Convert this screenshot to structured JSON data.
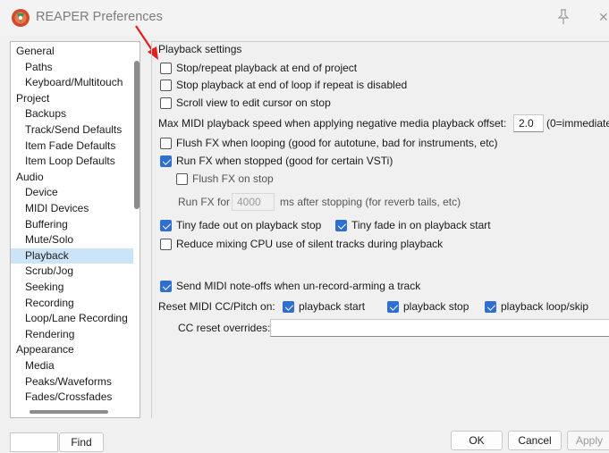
{
  "window": {
    "title": "REAPER Preferences"
  },
  "categories": [
    {
      "label": "General",
      "level": 0
    },
    {
      "label": "Paths",
      "level": 1
    },
    {
      "label": "Keyboard/Multitouch",
      "level": 1
    },
    {
      "label": "Project",
      "level": 0
    },
    {
      "label": "Backups",
      "level": 1
    },
    {
      "label": "Track/Send Defaults",
      "level": 1
    },
    {
      "label": "Item Fade Defaults",
      "level": 1
    },
    {
      "label": "Item Loop Defaults",
      "level": 1
    },
    {
      "label": "Audio",
      "level": 0
    },
    {
      "label": "Device",
      "level": 1
    },
    {
      "label": "MIDI Devices",
      "level": 1
    },
    {
      "label": "Buffering",
      "level": 1
    },
    {
      "label": "Mute/Solo",
      "level": 1
    },
    {
      "label": "Playback",
      "level": 1,
      "selected": true
    },
    {
      "label": "Scrub/Jog",
      "level": 1
    },
    {
      "label": "Seeking",
      "level": 1
    },
    {
      "label": "Recording",
      "level": 1
    },
    {
      "label": "Loop/Lane Recording",
      "level": 1
    },
    {
      "label": "Rendering",
      "level": 1
    },
    {
      "label": "Appearance",
      "level": 0
    },
    {
      "label": "Media",
      "level": 1
    },
    {
      "label": "Peaks/Waveforms",
      "level": 1
    },
    {
      "label": "Fades/Crossfades",
      "level": 1
    }
  ],
  "playback": {
    "section_title": "Playback settings",
    "stop_repeat_end_of_project": {
      "label": "Stop/repeat playback at end of project",
      "checked": false
    },
    "stop_end_of_loop": {
      "label": "Stop playback at end of loop if repeat is disabled",
      "checked": false
    },
    "scroll_view_cursor": {
      "label": "Scroll view to edit cursor on stop",
      "checked": false
    },
    "max_midi_speed": {
      "label": "Max MIDI playback speed when applying negative media playback offset:",
      "value": "2.0",
      "hint": "(0=immediate)"
    },
    "flush_fx_looping": {
      "label": "Flush FX when looping (good for autotune, bad for instruments, etc)",
      "checked": false
    },
    "run_fx_stopped": {
      "label": "Run FX when stopped (good for certain VSTi)",
      "checked": true
    },
    "flush_fx_stop": {
      "label": "Flush FX on stop",
      "checked": false
    },
    "run_fx_for": {
      "prefix": "Run FX for",
      "value": "4000",
      "suffix": "ms after stopping (for reverb tails, etc)"
    },
    "tiny_fade_out": {
      "label": "Tiny fade out on playback stop",
      "checked": true
    },
    "tiny_fade_in": {
      "label": "Tiny fade in on playback start",
      "checked": true
    },
    "reduce_cpu": {
      "label": "Reduce mixing CPU use of silent tracks during playback",
      "checked": false
    },
    "send_midi_noteoffs": {
      "label": "Send MIDI note-offs when un-record-arming a track",
      "checked": true
    },
    "reset_midi_label": "Reset MIDI CC/Pitch on:",
    "reset_playback_start": {
      "label": "playback start",
      "checked": true
    },
    "reset_playback_stop": {
      "label": "playback stop",
      "checked": true
    },
    "reset_playback_loop": {
      "label": "playback loop/skip",
      "checked": true
    },
    "cc_reset_overrides": {
      "label": "CC reset overrides:",
      "value": ""
    }
  },
  "bottom": {
    "find_label": "Find",
    "ok_label": "OK",
    "cancel_label": "Cancel",
    "apply_label": "Apply"
  },
  "colors": {
    "accent_check": "#2f6fcf",
    "selection": "#cce4f7",
    "annotation_arrow": "#e0201b"
  }
}
